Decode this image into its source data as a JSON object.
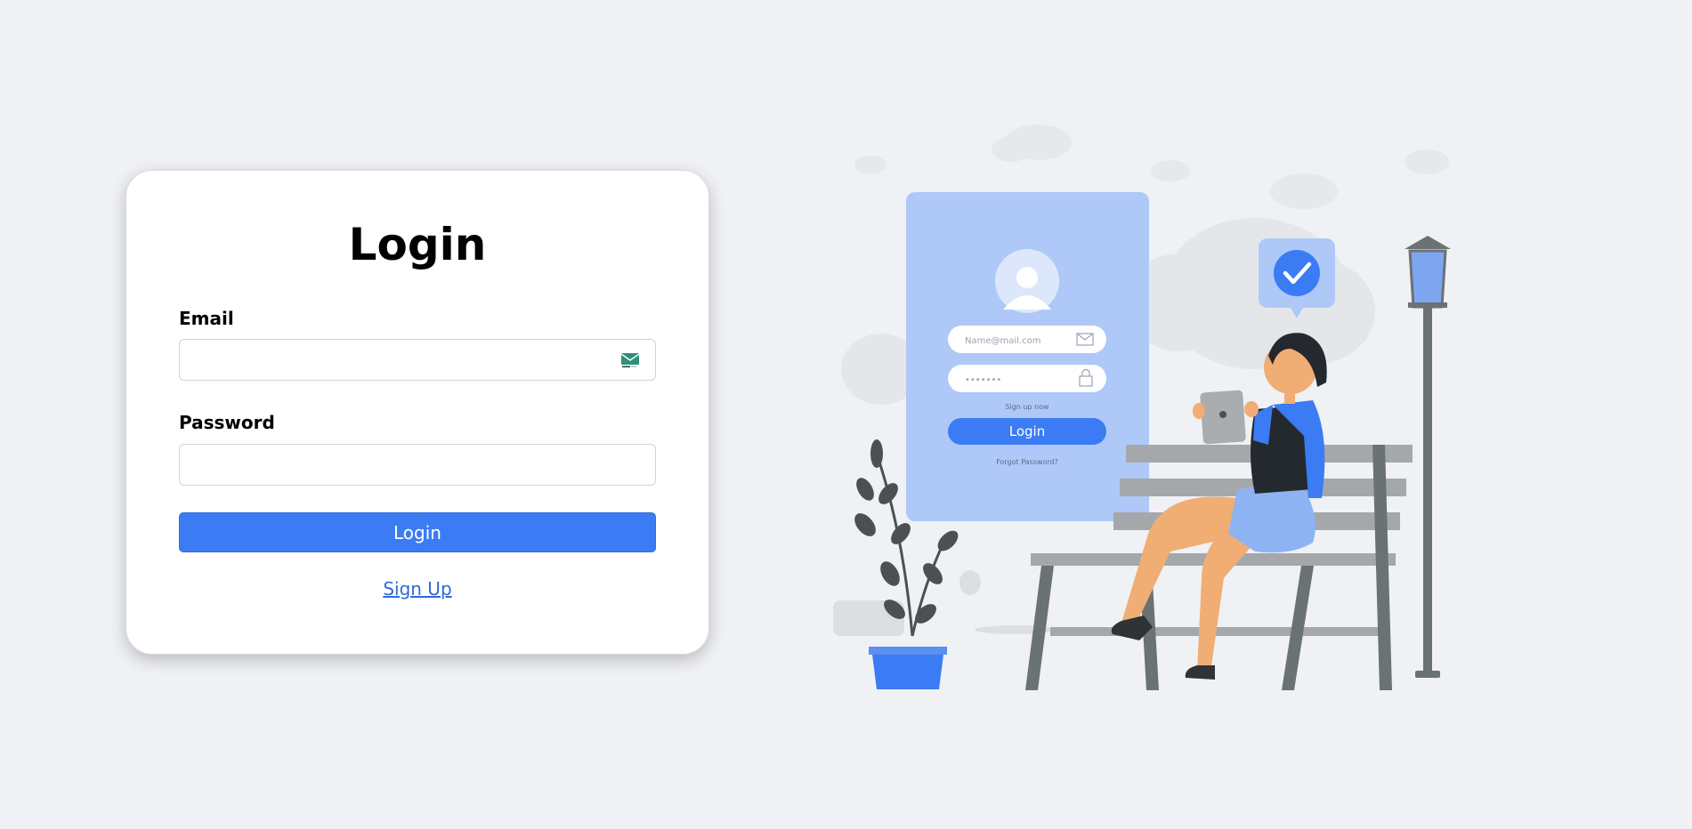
{
  "login_card": {
    "title": "Login",
    "email_label": "Email",
    "email_value": "",
    "password_label": "Password",
    "password_value": "",
    "login_button": "Login",
    "signup_link": "Sign Up"
  },
  "illustration": {
    "form_email_placeholder": "Name@mail.com",
    "form_password_mask": "•••••••",
    "form_signup_text": "Sign up now",
    "form_login_button": "Login",
    "form_forgot_password": "Forgot Password?"
  },
  "colors": {
    "background": "#eff1f5",
    "accent": "#3b7cf4",
    "link": "#2d6ad8",
    "illustration_panel": "#aec8f8"
  },
  "icons": [
    "mail-icon",
    "user-avatar-icon",
    "envelope-icon",
    "lock-icon",
    "check-icon"
  ]
}
